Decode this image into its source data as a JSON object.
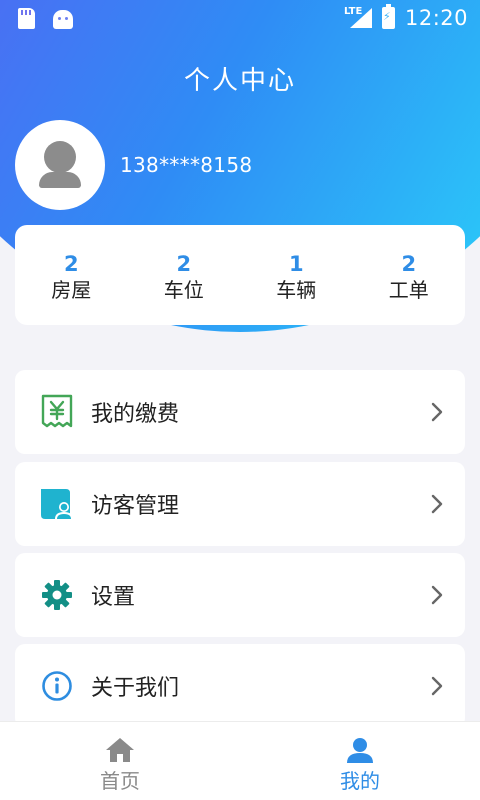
{
  "status_bar": {
    "network": "LTE",
    "time": "12:20"
  },
  "header": {
    "title": "个人中心"
  },
  "profile": {
    "phone": "138****8158"
  },
  "stats": [
    {
      "value": "2",
      "label": "房屋"
    },
    {
      "value": "2",
      "label": "车位"
    },
    {
      "value": "1",
      "label": "车辆"
    },
    {
      "value": "2",
      "label": "工单"
    }
  ],
  "menu": [
    {
      "label": "我的缴费",
      "icon": "receipt-yen-icon"
    },
    {
      "label": "访客管理",
      "icon": "visitor-icon"
    },
    {
      "label": "设置",
      "icon": "gear-icon"
    },
    {
      "label": "关于我们",
      "icon": "info-icon"
    }
  ],
  "tabbar": {
    "home_label": "首页",
    "mine_label": "我的",
    "active": "mine"
  },
  "colors": {
    "accent": "#2f8de6",
    "inactive": "#8a8a8a",
    "pay_icon": "#43a657",
    "visitor_icon": "#1fb3cf",
    "settings_icon": "#138f86",
    "info_icon": "#2e8de0"
  }
}
